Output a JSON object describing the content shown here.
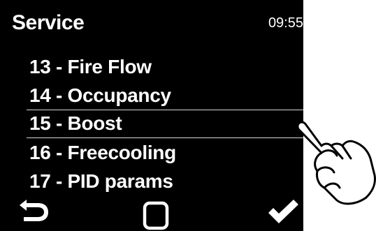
{
  "header": {
    "title": "Service",
    "clock": "09:55"
  },
  "menu": {
    "items": [
      {
        "label": "13 - Fire Flow",
        "selected": false
      },
      {
        "label": "14 - Occupancy",
        "selected": false
      },
      {
        "label": "15 - Boost",
        "selected": true
      },
      {
        "label": "16 - Freecooling",
        "selected": false
      },
      {
        "label": "17 - PID params",
        "selected": false
      }
    ]
  },
  "bottom_bar": {
    "back_icon": "back-arrow-icon",
    "home_icon": "square-home-icon",
    "confirm_icon": "checkmark-icon"
  },
  "overlay": {
    "hand_icon": "pointing-hand-icon"
  },
  "colors": {
    "screen_background": "#000000",
    "text": "#ffffff",
    "selection_lines": "#d8d8d8"
  }
}
